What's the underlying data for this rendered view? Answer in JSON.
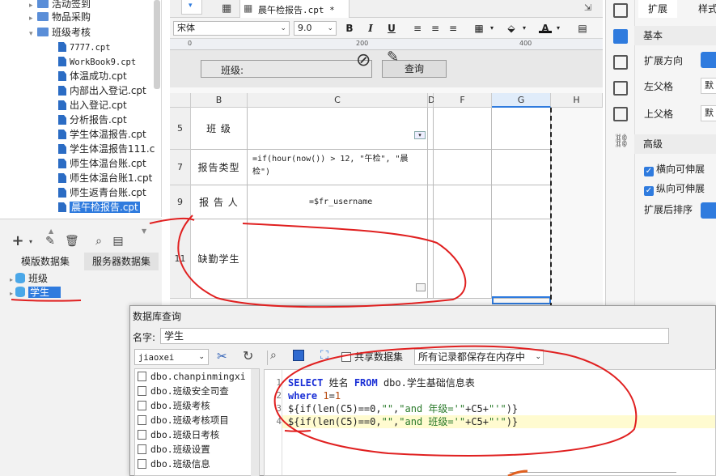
{
  "tree": {
    "items": [
      {
        "label": "活动签到",
        "type": "folder"
      },
      {
        "label": "物品采购",
        "type": "folder"
      },
      {
        "label": "班级考核",
        "type": "folder",
        "open": true
      },
      {
        "label": "7777.cpt",
        "type": "file"
      },
      {
        "label": "WorkBook9.cpt",
        "type": "file"
      },
      {
        "label": "体温成功.cpt",
        "type": "file"
      },
      {
        "label": "内部出入登记.cpt",
        "type": "file"
      },
      {
        "label": "出入登记.cpt",
        "type": "file"
      },
      {
        "label": "分析报告.cpt",
        "type": "file"
      },
      {
        "label": "学生体温报告.cpt",
        "type": "file"
      },
      {
        "label": "学生体温报告111.c",
        "type": "file"
      },
      {
        "label": "师生体温台账.cpt",
        "type": "file"
      },
      {
        "label": "师生体温台账1.cpt",
        "type": "file"
      },
      {
        "label": "师生返青台账.cpt",
        "type": "file"
      },
      {
        "label": "晨午检报告.cpt",
        "type": "file",
        "selected": true
      }
    ]
  },
  "datasets": {
    "tabs": [
      "模版数据集",
      "服务器数据集"
    ],
    "items": [
      "班级",
      "学生"
    ]
  },
  "file_tab": {
    "label": "晨午检报告.cpt *"
  },
  "format_bar": {
    "font": "宋体",
    "size": "9.0",
    "bold": "B",
    "italic": "I",
    "underline": "U"
  },
  "ruler": {
    "marks": [
      "0",
      "200",
      "400"
    ]
  },
  "params": {
    "label": "班级:",
    "query_button": "查询"
  },
  "columns": [
    "B",
    "C",
    "D",
    "F",
    "G",
    "H"
  ],
  "rows": [
    {
      "num": "5",
      "label": "班  级",
      "content": ""
    },
    {
      "num": "7",
      "label": "报告类型",
      "content": "=if(hour(now()) > 12, \"午检\", \"晨检\")"
    },
    {
      "num": "9",
      "label": "报 告 人",
      "content": "=$fr_username"
    },
    {
      "num": "11",
      "label": "缺勤学生",
      "content": ""
    }
  ],
  "props": {
    "tabs": [
      "扩展",
      "样式"
    ],
    "basic_title": "基本",
    "expand_direction": "扩展方向",
    "left_parent": "左父格",
    "left_parent_val": "默",
    "top_parent": "上父格",
    "top_parent_val": "默",
    "advanced_title": "高级",
    "h_stretch": "横向可伸展",
    "v_stretch": "纵向可伸展",
    "sort_after": "扩展后排序"
  },
  "dialog": {
    "title": "数据库查询",
    "name_label": "名字:",
    "name_value": "学生",
    "connection": "jiaoxei",
    "shared_dataset": "共享数据集",
    "cache_mode": "所有记录都保存在内存中",
    "tables": [
      "dbo.chanpinmingxi",
      "dbo.班级安全司查",
      "dbo.班级考核",
      "dbo.班级考核项目",
      "dbo.班级日考核",
      "dbo.班级设置",
      "dbo.班级信息"
    ],
    "sql_lines": [
      "1",
      "2",
      "3",
      "4"
    ]
  },
  "colors": {
    "accent": "#2f7bde",
    "annotation": "#e02020",
    "keyword": "#1a2fd6"
  }
}
